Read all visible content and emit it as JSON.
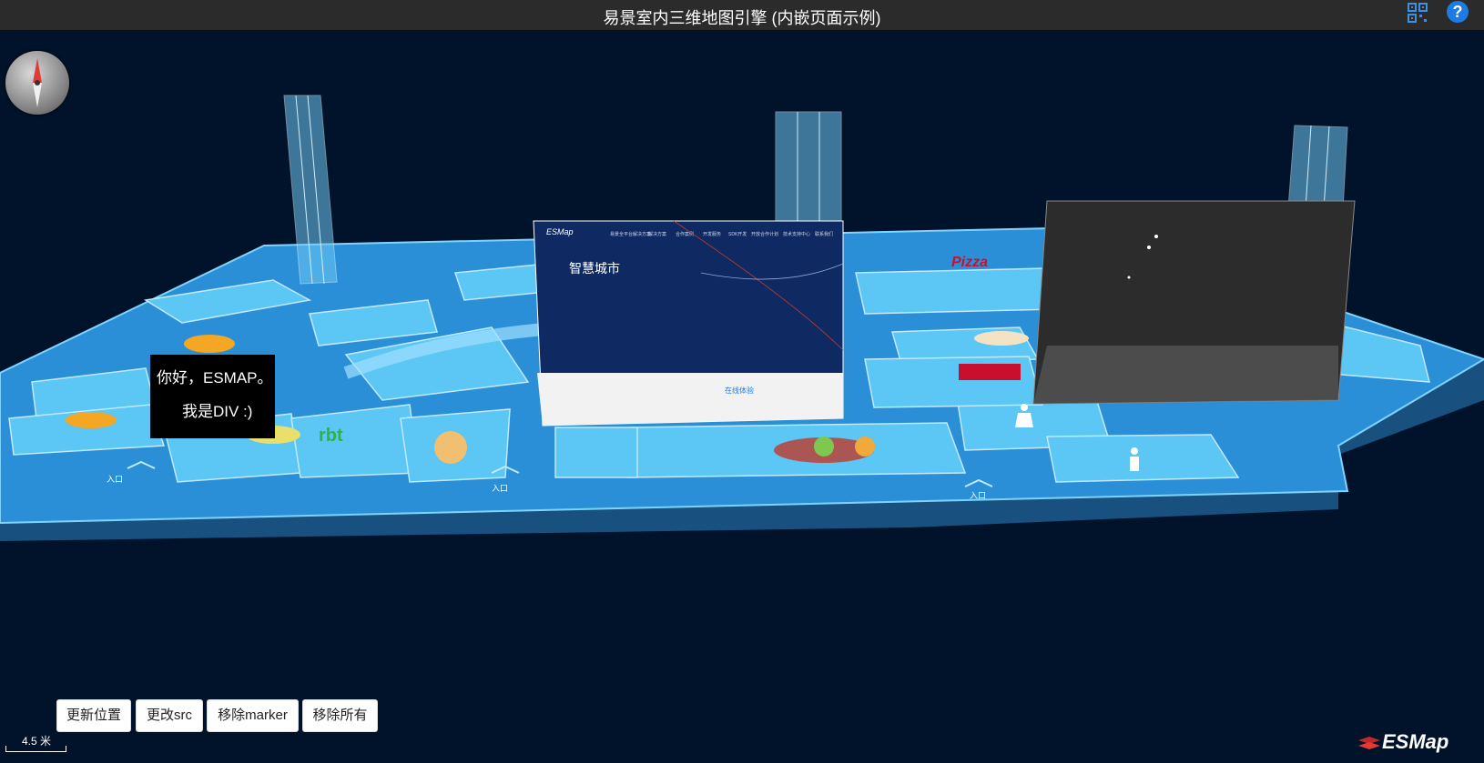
{
  "window": {
    "title": "易景室内三维地图引擎 (内嵌页面示例)"
  },
  "header_icons": [
    "qr-code-icon",
    "help-icon"
  ],
  "help_glyph": "?",
  "div_marker": {
    "line1": "你好，ESMAP。",
    "line2": "我是DIV :)"
  },
  "iframe_marker": {
    "brand": "ESMap",
    "nav_items": [
      "易景全平台解决方案",
      "解决方案",
      "合作案例",
      "开发服务",
      "SDK开发",
      "开放合作计划",
      "技术支持中心",
      "联系我们"
    ],
    "heading": "智慧城市",
    "cta": "在线体验"
  },
  "buttons": {
    "update_position": "更新位置",
    "change_src": "更改src",
    "remove_marker": "移除marker",
    "remove_all": "移除所有"
  },
  "scale": {
    "label": "4.5 米"
  },
  "brand": {
    "name": "ESMap"
  },
  "map_labels": {
    "entrance": "入口"
  },
  "colors": {
    "background": "#00132a",
    "floor": "#2a8fd6",
    "rooms": "#5cc6f5",
    "titlebar": "#2b2b2b",
    "accent": "#1e7be3"
  }
}
